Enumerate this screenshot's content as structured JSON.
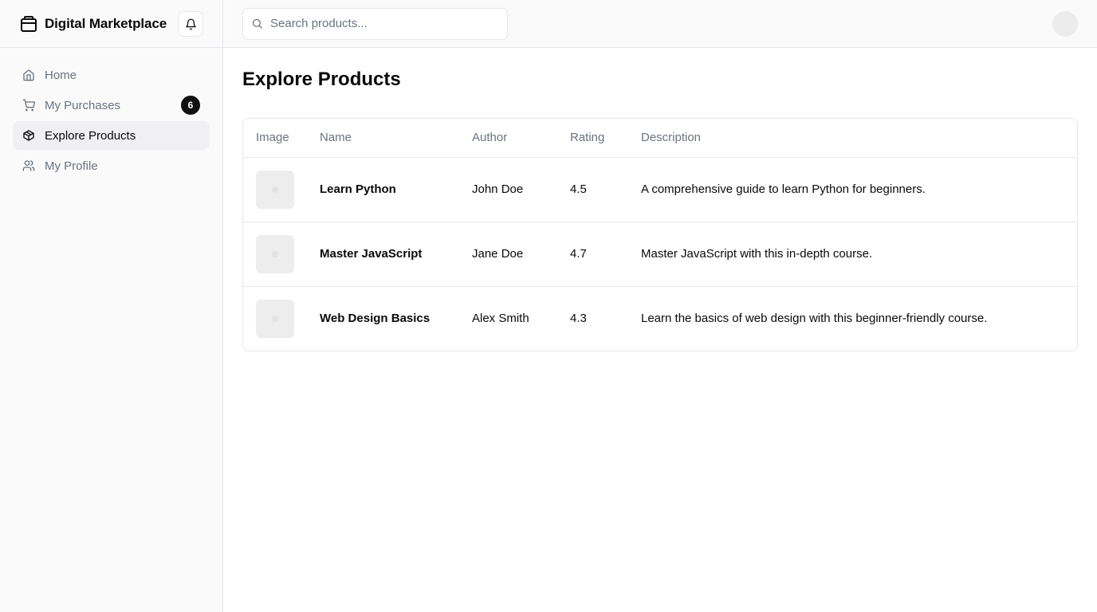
{
  "app": {
    "title": "Digital Marketplace"
  },
  "icons": {
    "brand": "package-icon",
    "bell": "bell-icon",
    "search": "search-icon",
    "home": "home-icon",
    "purchases": "shopping-cart-icon",
    "explore": "box-icon",
    "profile": "users-icon"
  },
  "sidebar": {
    "items": [
      {
        "label": "Home",
        "active": false
      },
      {
        "label": "My Purchases",
        "active": false,
        "badge": "6"
      },
      {
        "label": "Explore Products",
        "active": true
      },
      {
        "label": "My Profile",
        "active": false
      }
    ]
  },
  "search": {
    "placeholder": "Search products..."
  },
  "main": {
    "title": "Explore Products",
    "table": {
      "headers": [
        "Image",
        "Name",
        "Author",
        "Rating",
        "Description"
      ],
      "rows": [
        {
          "name": "Learn Python",
          "author": "John Doe",
          "rating": "4.5",
          "description": "A comprehensive guide to learn Python for beginners."
        },
        {
          "name": "Master JavaScript",
          "author": "Jane Doe",
          "rating": "4.7",
          "description": "Master JavaScript with this in-depth course."
        },
        {
          "name": "Web Design Basics",
          "author": "Alex Smith",
          "rating": "4.3",
          "description": "Learn the basics of web design with this beginner-friendly course."
        }
      ]
    }
  },
  "colors": {
    "accent": "#111111",
    "muted_text": "#6b7280",
    "border": "#e5e7eb",
    "sidebar_bg": "#fafafa",
    "active_bg": "#f0f0f2"
  }
}
